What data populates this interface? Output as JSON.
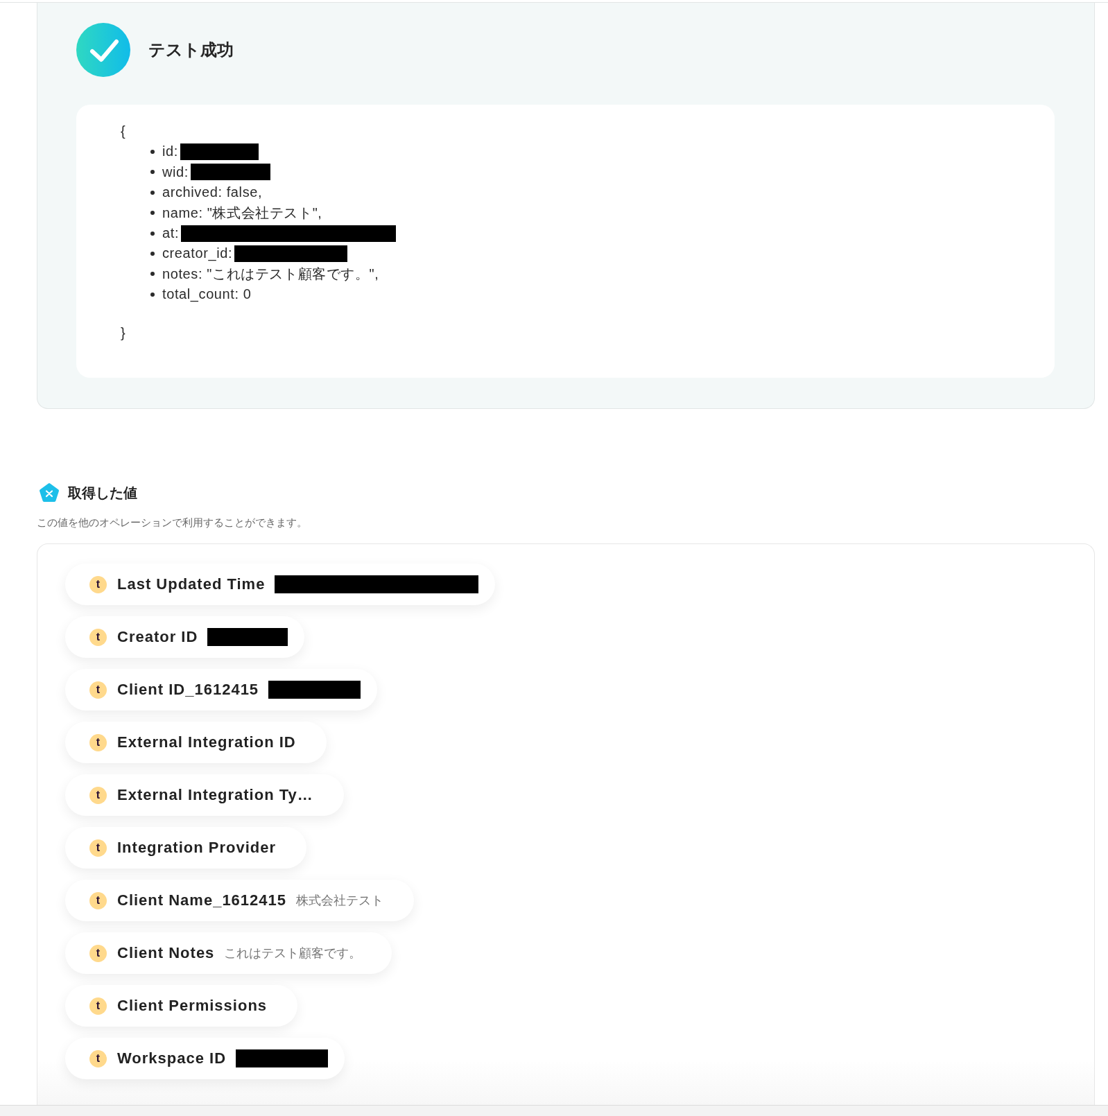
{
  "test_result": {
    "title": "テスト成功"
  },
  "code_block": {
    "open": "{",
    "lines": [
      {
        "text": "id:",
        "redacted": true
      },
      {
        "text": "wid:",
        "redacted": true
      },
      {
        "text": "archived: false,",
        "redacted": false
      },
      {
        "text": "name: \"株式会社テスト\",",
        "redacted": false
      },
      {
        "text": "at:",
        "redacted": true
      },
      {
        "text": "creator_id:",
        "redacted": true
      },
      {
        "text": "notes: \"これはテスト顧客です。\",",
        "redacted": false
      },
      {
        "text": "total_count: 0",
        "redacted": false
      }
    ],
    "close": "}"
  },
  "values_section": {
    "title": "取得した値",
    "subtitle": "この値を他のオペレーションで利用することができます。",
    "items": [
      {
        "type_badge": "t",
        "label": "Last Updated Time",
        "redacted": true
      },
      {
        "type_badge": "t",
        "label": "Creator ID",
        "redacted": true
      },
      {
        "type_badge": "t",
        "label": "Client ID_1612415",
        "redacted": true
      },
      {
        "type_badge": "t",
        "label": "External Integration ID",
        "redacted": false
      },
      {
        "type_badge": "t",
        "label": "External Integration Ty…",
        "redacted": false
      },
      {
        "type_badge": "t",
        "label": "Integration Provider",
        "redacted": false
      },
      {
        "type_badge": "t",
        "label": "Client Name_1612415",
        "value": "株式会社テスト",
        "redacted": false
      },
      {
        "type_badge": "t",
        "label": "Client Notes",
        "value": "これはテスト顧客です。",
        "redacted": false
      },
      {
        "type_badge": "t",
        "label": "Client Permissions",
        "redacted": false
      },
      {
        "type_badge": "t",
        "label": "Workspace ID",
        "redacted": true
      }
    ]
  }
}
